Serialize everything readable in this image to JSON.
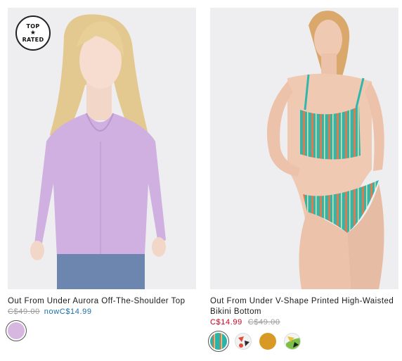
{
  "products": [
    {
      "badge": {
        "line1": "TOP",
        "icon": "star-icon",
        "line2": "RATED"
      },
      "title": "Out From Under Aurora Off-The-Shoulder Top",
      "original_price": "C$49.00",
      "sale_prefix": "now",
      "sale_price": "C$14.99",
      "price_colors": {
        "sale": "#1c6fa8",
        "original": "#9a9a9a"
      },
      "swatches": [
        {
          "name": "lavender",
          "color": "#d7b6e0",
          "selected": true
        }
      ]
    },
    {
      "title_line1": "Out From Under V-Shape Printed High-Waisted",
      "title_line2": "Bikini Bottom",
      "sale_price": "C$14.99",
      "original_price": "C$49.00",
      "price_colors": {
        "sale": "#d0021b",
        "original": "#9a9a9a"
      },
      "swatches": [
        {
          "name": "teal-stripe",
          "color": "#2ab3a8",
          "selected": true
        },
        {
          "name": "white-print",
          "color": "#f2f2f2",
          "selected": false
        },
        {
          "name": "mustard",
          "color": "#d99a25",
          "selected": false
        },
        {
          "name": "green-print",
          "color": "#7cc04a",
          "selected": false
        }
      ]
    }
  ]
}
